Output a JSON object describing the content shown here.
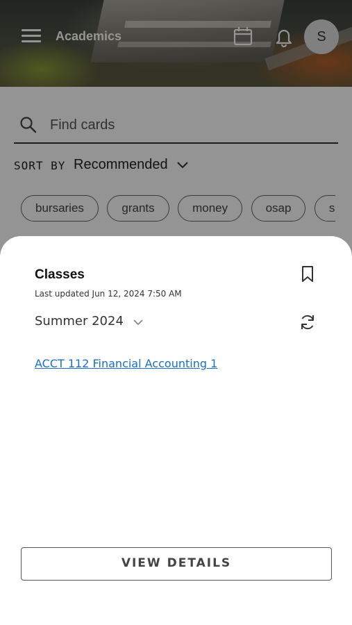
{
  "header": {
    "title": "Academics",
    "menu_icon": "hamburger-menu-icon",
    "calendar_icon": "calendar-icon",
    "notifications_icon": "bell-icon",
    "avatar_initial": "S"
  },
  "search": {
    "placeholder": "Find cards",
    "value": "",
    "icon": "search-icon"
  },
  "sort": {
    "label": "SORT BY",
    "value": "Recommended"
  },
  "filters": {
    "chips": [
      "bursaries",
      "grants",
      "money",
      "osap",
      "s"
    ]
  },
  "sheet": {
    "title": "Classes",
    "last_updated": "Last updated Jun 12, 2024 7:50 AM",
    "term": "Summer 2024",
    "classes": [
      "ACCT 112 Financial Accounting 1"
    ],
    "view_details_label": "VIEW DETAILS",
    "bookmark_icon": "bookmark-icon",
    "refresh_icon": "refresh-icon"
  },
  "colors": {
    "link": "#1a6fc9",
    "scrim": "rgba(0,0,0,0.42)"
  }
}
